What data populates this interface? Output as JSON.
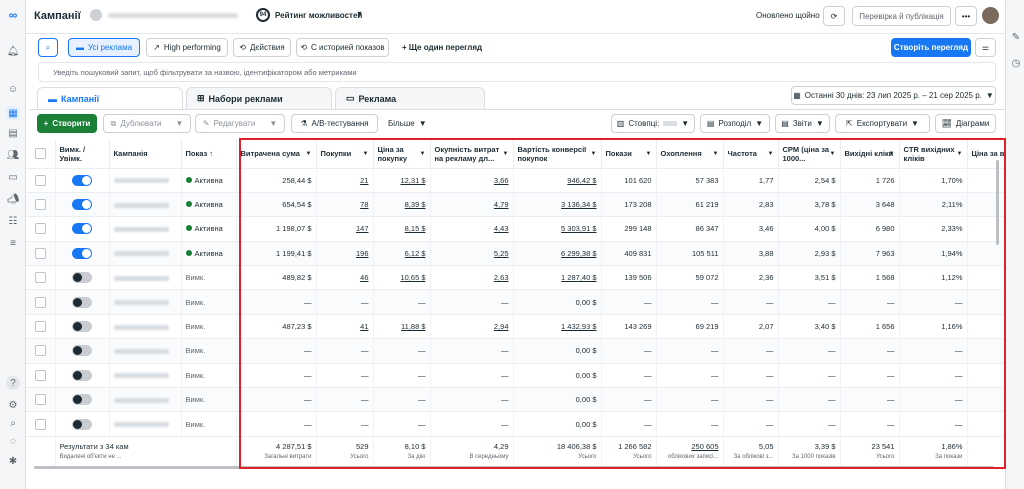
{
  "header": {
    "title": "Кампанії",
    "score": "94",
    "score_label": "Рейтинг можливостей",
    "status": "Оновлено щойно",
    "review_btn": "Перевірка й публікація",
    "more_btn": "•••"
  },
  "views": {
    "all": "Усі реклама",
    "high": "High performing",
    "actions": "Дєйствия",
    "history": "С историей показов",
    "add": "+ Ще один перегляд",
    "create": "Створіть перегляд"
  },
  "search": {
    "placeholder": "Уведіть пошуковий запит, щоб фільтрувати за назвою, ідентифікатором або метриками"
  },
  "tabs": {
    "campaigns": "Кампанії",
    "adsets": "Набори реклами",
    "ads": "Реклама"
  },
  "date_range": "Останні 30 днів: 23 лип 2025 р. – 21 сер 2025 р.",
  "toolbar": {
    "create": "Створити",
    "duplicate": "Дублювати",
    "edit": "Редагувати",
    "ab": "A/B-тестування",
    "more": "Більше",
    "columns": "Стовпці:",
    "breakdown": "Розподіл",
    "reports": "Звіти",
    "export": "Експортувати",
    "charts": "Діаграми"
  },
  "columns": [
    "Вимк. / Увімк.",
    "Кампанія",
    "Показ ↑",
    "Витрачена сума",
    "Покупки",
    "Ціна за покупку",
    "Окупність витрат на рекламу дл...",
    "Вартість конверсії покупок",
    "Покази",
    "Охоплення",
    "Частота",
    "CPM (ціна за 1000...",
    "Вихідні кліки",
    "CTR вихідних кліків",
    "Ціна за вихід"
  ],
  "rows": [
    {
      "on": true,
      "status": "Активна",
      "spend": "258,44 $",
      "purch": "21",
      "cpp": "12,31 $",
      "roas": "3,66",
      "conv": "946,42 $",
      "impr": "101 620",
      "reach": "57 383",
      "freq": "1,77",
      "cpm": "2,54 $",
      "clicks": "1 726",
      "ctr": "1,70%"
    },
    {
      "on": true,
      "status": "Активна",
      "spend": "654,54 $",
      "purch": "78",
      "cpp": "8,39 $",
      "roas": "4,79",
      "conv": "3 136,34 $",
      "impr": "173 208",
      "reach": "61 219",
      "freq": "2,83",
      "cpm": "3,78 $",
      "clicks": "3 648",
      "ctr": "2,11%"
    },
    {
      "on": true,
      "status": "Активна",
      "spend": "1 198,07 $",
      "purch": "147",
      "cpp": "8,15 $",
      "roas": "4,43",
      "conv": "5 303,91 $",
      "impr": "299 148",
      "reach": "86 347",
      "freq": "3,46",
      "cpm": "4,00 $",
      "clicks": "6 980",
      "ctr": "2,33%"
    },
    {
      "on": true,
      "status": "Активна",
      "spend": "1 199,41 $",
      "purch": "196",
      "cpp": "6,12 $",
      "roas": "5,25",
      "conv": "6 299,38 $",
      "impr": "409 831",
      "reach": "105 511",
      "freq": "3,88",
      "cpm": "2,93 $",
      "clicks": "7 963",
      "ctr": "1,94%"
    },
    {
      "on": false,
      "status": "Вимк.",
      "spend": "489,82 $",
      "purch": "46",
      "cpp": "10,65 $",
      "roas": "2,63",
      "conv": "1 287,40 $",
      "impr": "139 506",
      "reach": "59 072",
      "freq": "2,36",
      "cpm": "3,51 $",
      "clicks": "1 568",
      "ctr": "1,12%"
    },
    {
      "on": false,
      "status": "Вимк.",
      "spend": "—",
      "purch": "—",
      "cpp": "—",
      "roas": "—",
      "conv": "0,00 $",
      "impr": "—",
      "reach": "—",
      "freq": "—",
      "cpm": "—",
      "clicks": "—",
      "ctr": "—"
    },
    {
      "on": false,
      "status": "Вимк.",
      "spend": "487,23 $",
      "purch": "41",
      "cpp": "11,88 $",
      "roas": "2,94",
      "conv": "1 432,93 $",
      "impr": "143 269",
      "reach": "69 219",
      "freq": "2,07",
      "cpm": "3,40 $",
      "clicks": "1 656",
      "ctr": "1,16%"
    },
    {
      "on": false,
      "status": "Вимк.",
      "spend": "—",
      "purch": "—",
      "cpp": "—",
      "roas": "—",
      "conv": "0,00 $",
      "impr": "—",
      "reach": "—",
      "freq": "—",
      "cpm": "—",
      "clicks": "—",
      "ctr": "—"
    },
    {
      "on": false,
      "status": "Вимк.",
      "spend": "—",
      "purch": "—",
      "cpp": "—",
      "roas": "—",
      "conv": "0,00 $",
      "impr": "—",
      "reach": "—",
      "freq": "—",
      "cpm": "—",
      "clicks": "—",
      "ctr": "—"
    },
    {
      "on": false,
      "status": "Вимк.",
      "spend": "—",
      "purch": "—",
      "cpp": "—",
      "roas": "—",
      "conv": "0,00 $",
      "impr": "—",
      "reach": "—",
      "freq": "—",
      "cpm": "—",
      "clicks": "—",
      "ctr": "—"
    },
    {
      "on": false,
      "status": "Вимк.",
      "spend": "—",
      "purch": "—",
      "cpp": "—",
      "roas": "—",
      "conv": "0,00 $",
      "impr": "—",
      "reach": "—",
      "freq": "—",
      "cpm": "—",
      "clicks": "—",
      "ctr": "—"
    }
  ],
  "totals": {
    "label": "Результати з 34 кам",
    "sub": "Видалені об'єкти не ...",
    "spend": "4 287,51 $",
    "spend_s": "Загальні витрати",
    "purch": "529",
    "purch_s": "Усього",
    "cpp": "8,10 $",
    "cpp_s": "За дію",
    "roas": "4,29",
    "roas_s": "В середньому",
    "conv": "18 406,38 $",
    "conv_s": "Усього",
    "impr": "1 266 582",
    "impr_s": "Усього",
    "reach": "250 605",
    "reach_s": "облікових записі...",
    "freq": "5,05",
    "freq_s": "За облікові з...",
    "cpm": "3,39 $",
    "cpm_s": "За 1000 показів",
    "clicks": "23 541",
    "clicks_s": "Усього",
    "ctr": "1,86%",
    "ctr_s": "За покази"
  }
}
